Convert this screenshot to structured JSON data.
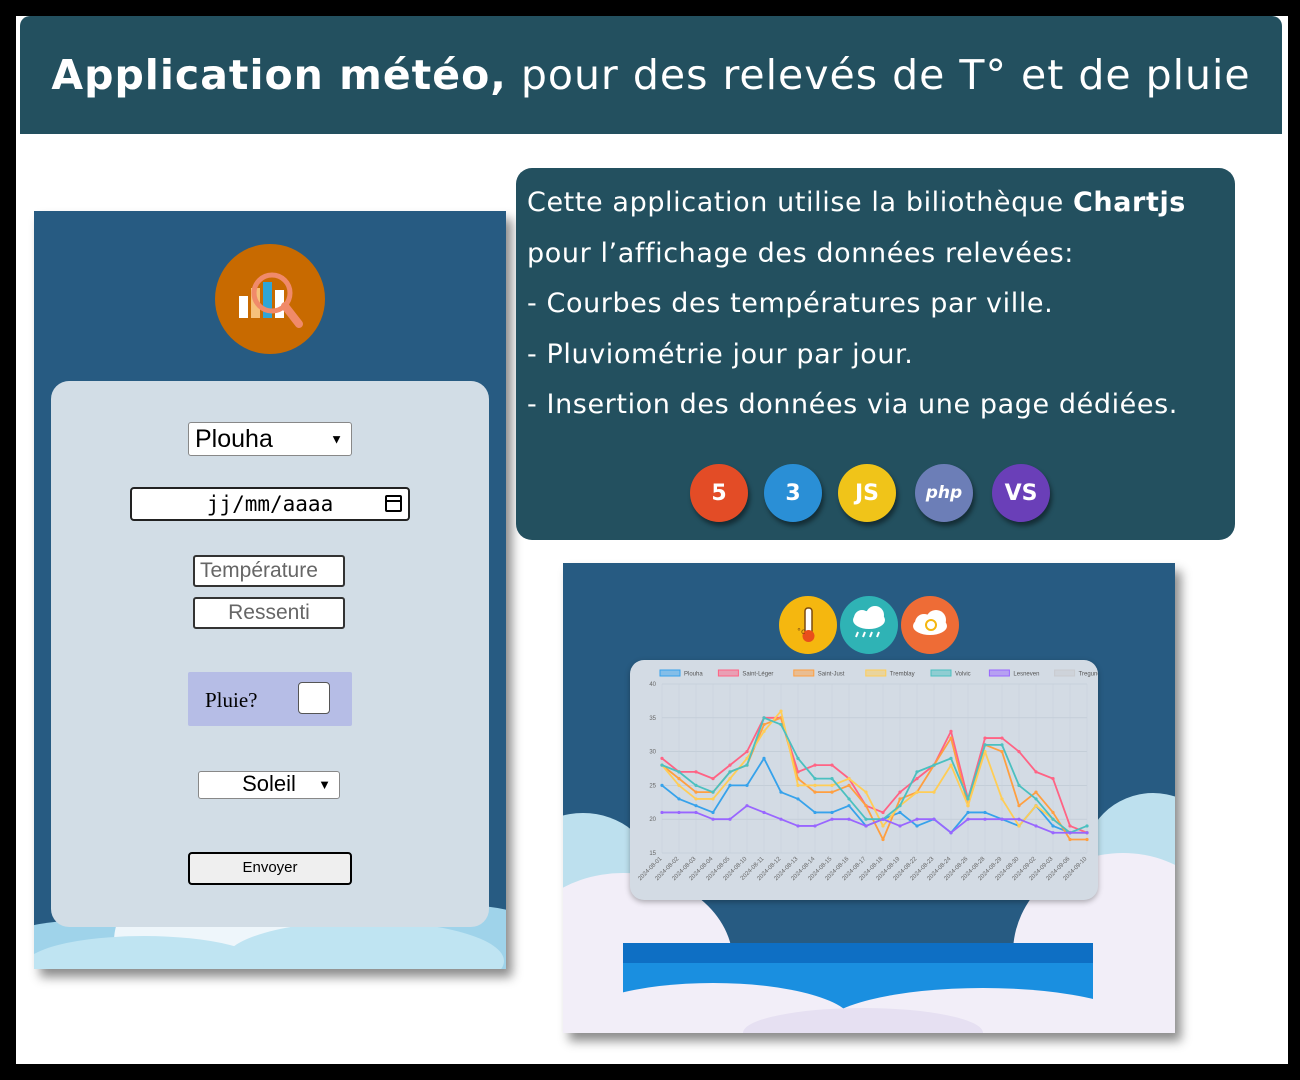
{
  "header": {
    "title_bold": "Application météo,",
    "title_rest": "pour des relevés de T° et de pluie"
  },
  "form": {
    "city_value": "Plouha",
    "date_placeholder": "jj/mm/aaaa",
    "temperature_placeholder": "Température",
    "ressenti_placeholder": "Ressenti",
    "pluie_label": "Pluie?",
    "pluie_checked": false,
    "weather_value": "Soleil",
    "submit_label": "Envoyer"
  },
  "info": {
    "line1_text": "Cette application utilise la biliothèque ",
    "line1_bold": "Chartjs",
    "line2": "pour l’affichage des données relevées:",
    "line3": "- Courbes des températures par ville.",
    "line4": "- Pluviométrie jour par jour.",
    "line5": "- Insertion des données via une page dédiées.",
    "tech_icons": [
      {
        "name": "html5-icon",
        "label": "5",
        "color": "#e34c26"
      },
      {
        "name": "css3-icon",
        "label": "3",
        "color": "#2a8fd6"
      },
      {
        "name": "javascript-icon",
        "label": "JS",
        "color": "#f0c419"
      },
      {
        "name": "php-icon",
        "label": "php",
        "color": "#6c7eb7"
      },
      {
        "name": "visual-studio-icon",
        "label": "VS",
        "color": "#6a3fb8"
      }
    ]
  },
  "screenshot": {
    "icons": [
      {
        "name": "thermometer-icon",
        "color": "#f5b70f"
      },
      {
        "name": "rain-cloud-icon",
        "color": "#2fb3b5"
      },
      {
        "name": "cloud-sync-icon",
        "color": "#ee6c36"
      }
    ]
  },
  "chart_data": {
    "type": "line",
    "x": [
      "2024-08-01",
      "2024-08-02",
      "2024-08-03",
      "2024-08-04",
      "2024-08-05",
      "2024-08-10",
      "2024-08-11",
      "2024-08-12",
      "2024-08-13",
      "2024-08-14",
      "2024-08-15",
      "2024-08-16",
      "2024-08-17",
      "2024-08-18",
      "2024-08-19",
      "2024-08-22",
      "2024-08-23",
      "2024-08-24",
      "2024-08-26",
      "2024-08-28",
      "2024-08-29",
      "2024-08-30",
      "2024-09-02",
      "2024-09-03",
      "2024-09-06",
      "2024-09-10"
    ],
    "ylim": [
      15,
      40
    ],
    "yticks": [
      15,
      20,
      25,
      30,
      35,
      40
    ],
    "grid": true,
    "legend_position": "top",
    "series": [
      {
        "name": "Plouha",
        "color": "#36a2eb",
        "values": [
          25,
          23,
          22,
          21,
          25,
          25,
          29,
          24,
          23,
          21,
          21,
          22,
          19,
          20,
          21,
          19,
          20,
          18,
          21,
          21,
          20,
          19,
          22,
          19,
          18,
          18
        ]
      },
      {
        "name": "Saint-Léger",
        "color": "#ff6384",
        "values": [
          29,
          27,
          27,
          26,
          28,
          30,
          35,
          35,
          27,
          28,
          28,
          26,
          22,
          21,
          24,
          26,
          28,
          33,
          23,
          32,
          32,
          30,
          27,
          26,
          19,
          18
        ]
      },
      {
        "name": "Saint-Just",
        "color": "#ff9f40",
        "values": [
          28,
          26,
          24,
          24,
          27,
          28,
          34,
          35,
          26,
          24,
          24,
          25,
          22,
          17,
          23,
          24,
          28,
          32,
          22,
          31,
          30,
          22,
          24,
          21,
          17,
          17
        ]
      },
      {
        "name": "Tremblay",
        "color": "#ffcd56",
        "values": [
          28,
          25,
          23,
          23,
          26,
          29,
          33,
          36,
          25,
          25,
          25,
          26,
          24,
          19,
          22,
          24,
          24,
          28,
          22,
          30,
          23,
          19,
          22,
          20,
          18,
          18
        ]
      },
      {
        "name": "Volvic",
        "color": "#4bc0c0",
        "values": [
          28,
          27,
          25,
          24,
          27,
          28,
          35,
          34,
          29,
          26,
          26,
          23,
          20,
          20,
          22,
          27,
          28,
          29,
          23,
          31,
          31,
          25,
          23,
          20,
          18,
          19
        ]
      },
      {
        "name": "Lesneven",
        "color": "#9966ff",
        "values": [
          21,
          21,
          21,
          20,
          20,
          22,
          21,
          20,
          19,
          19,
          20,
          20,
          19,
          20,
          19,
          20,
          20,
          18,
          20,
          20,
          20,
          20,
          19,
          18,
          18,
          18
        ]
      },
      {
        "name": "Tregunc",
        "color": "#c9cbcf",
        "values": []
      }
    ]
  }
}
